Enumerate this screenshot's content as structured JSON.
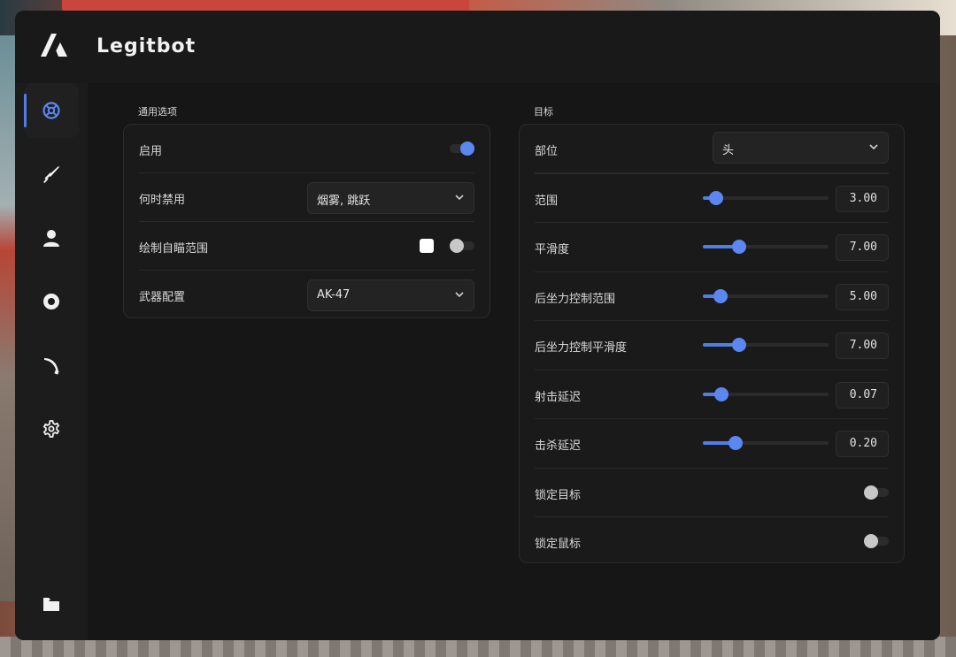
{
  "app": {
    "title": "Legitbot"
  },
  "sidebar": {
    "items": [
      {
        "icon": "crosshair-icon",
        "active": true
      },
      {
        "icon": "sword-icon",
        "active": false
      },
      {
        "icon": "user-icon",
        "active": false
      },
      {
        "icon": "eye-icon",
        "active": false
      },
      {
        "icon": "knife-icon",
        "active": false
      },
      {
        "icon": "gear-icon",
        "active": false
      },
      {
        "icon": "folder-icon",
        "active": false
      }
    ]
  },
  "general": {
    "title": "通用选项",
    "rows": [
      {
        "label": "启用",
        "type": "toggle",
        "on": true
      },
      {
        "label": "何时禁用",
        "type": "select",
        "value": "烟雾, 跳跃"
      },
      {
        "label": "绘制自瞄范围",
        "type": "color-toggle",
        "on": false,
        "color": "#ffffff"
      },
      {
        "label": "武器配置",
        "type": "select",
        "value": "AK-47"
      }
    ]
  },
  "target": {
    "title": "目标",
    "part": {
      "label": "部位",
      "value": "头"
    },
    "sliders": [
      {
        "label": "范围",
        "value": "3.00",
        "fraction": 0.08
      },
      {
        "label": "平滑度",
        "value": "7.00",
        "fraction": 0.26
      },
      {
        "label": "后坐力控制范围",
        "value": "5.00",
        "fraction": 0.11
      },
      {
        "label": "后坐力控制平滑度",
        "value": "7.00",
        "fraction": 0.26
      },
      {
        "label": "射击延迟",
        "value": "0.07",
        "fraction": 0.12
      },
      {
        "label": "击杀延迟",
        "value": "0.20",
        "fraction": 0.23
      }
    ],
    "toggles": [
      {
        "label": "锁定目标",
        "on": false
      },
      {
        "label": "锁定鼠标",
        "on": false
      }
    ]
  },
  "colors": {
    "accent": "#4f7dea",
    "knob_off": "#c8c8c8"
  }
}
